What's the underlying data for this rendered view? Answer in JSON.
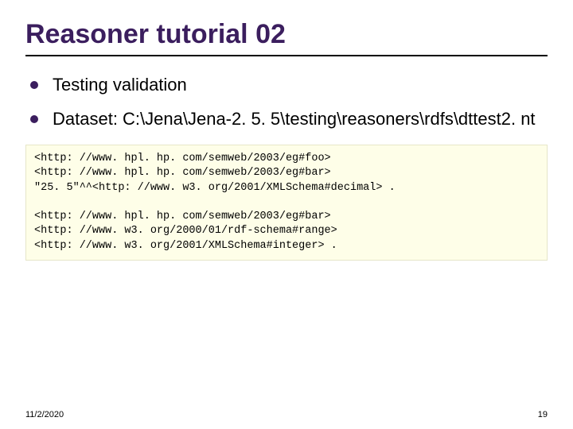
{
  "title": "Reasoner tutorial 02",
  "bullets": [
    "Testing validation",
    "Dataset: C:\\Jena\\Jena-2. 5. 5\\testing\\reasoners\\rdfs\\dttest2. nt"
  ],
  "code": "<http: //www. hpl. hp. com/semweb/2003/eg#foo>\n<http: //www. hpl. hp. com/semweb/2003/eg#bar>\n\"25. 5\"^^<http: //www. w3. org/2001/XMLSchema#decimal> .\n\n<http: //www. hpl. hp. com/semweb/2003/eg#bar>\n<http: //www. w3. org/2000/01/rdf-schema#range>\n<http: //www. w3. org/2001/XMLSchema#integer> .",
  "footer": {
    "date": "11/2/2020",
    "page": "19"
  }
}
